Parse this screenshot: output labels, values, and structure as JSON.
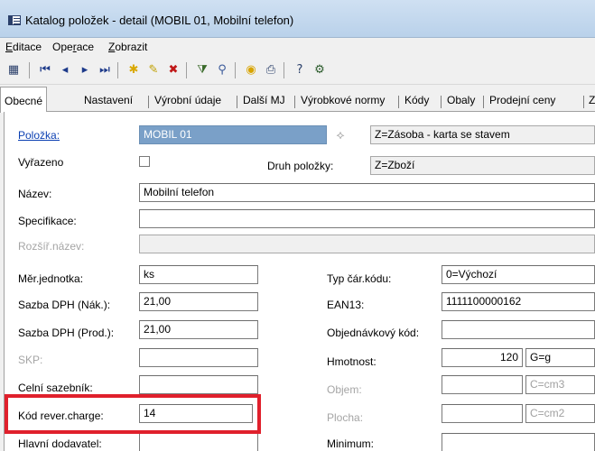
{
  "window": {
    "title": "Katalog položek - detail (MOBIL 01, Mobilní telefon)"
  },
  "menu": {
    "items": [
      {
        "u": "E",
        "rest": "ditace"
      },
      {
        "pre": "Ope",
        "u": "r",
        "rest": "ace"
      },
      {
        "u": "Z",
        "rest": "obrazit"
      }
    ]
  },
  "toolbar": {
    "icons": [
      "table-icon",
      "first-record-icon",
      "previous-record-icon",
      "next-record-icon",
      "last-record-icon",
      "new-record-icon",
      "edit-record-icon",
      "delete-record-icon",
      "filter-icon",
      "find-icon",
      "coins-icon",
      "print-icon",
      "help-icon",
      "tools-icon"
    ]
  },
  "tabs": [
    "Obecné",
    "Nastavení",
    "Výrobní údaje",
    "Další MJ",
    "Výrobkové normy",
    "Kódy",
    "Obaly",
    "Prodejní ceny",
    "Z"
  ],
  "form": {
    "polozka": {
      "label": "Položka:",
      "value": "MOBIL 01",
      "type_value": "Z=Zásoba - karta se stavem"
    },
    "vyrazeno": {
      "label": "Vyřazeno",
      "checked": false
    },
    "druh": {
      "label": "Druh položky:",
      "value": "Z=Zboží"
    },
    "nazev": {
      "label": "Název:",
      "value": "Mobilní telefon"
    },
    "specifikace": {
      "label": "Specifikace:",
      "value": ""
    },
    "rozsir_nazev": {
      "label": "Rozšíř.název:",
      "value": ""
    },
    "mer_jednotka": {
      "label": "Měr.jednotka:",
      "value": "ks"
    },
    "sazba_nak": {
      "label": "Sazba DPH (Nák.):",
      "value": "21,00"
    },
    "sazba_prod": {
      "label": "Sazba DPH (Prod.):",
      "value": "21,00"
    },
    "skp": {
      "label": "SKP:",
      "value": ""
    },
    "celni": {
      "label": "Celní sazebník:",
      "value": ""
    },
    "kod_rever": {
      "label": "Kód rever.charge:",
      "value": "14"
    },
    "hlavni_dodavatel": {
      "label": "Hlavní dodavatel:",
      "value": ""
    },
    "typ_car_kodu": {
      "label": "Typ čár.kódu:",
      "value": "0=Výchozí"
    },
    "ean13": {
      "label": "EAN13:",
      "value": "1111100000162"
    },
    "objednavkovy": {
      "label": "Objednávkový kód:",
      "value": ""
    },
    "hmotnost": {
      "label": "Hmotnost:",
      "value": "120",
      "unit": "G=g"
    },
    "objem": {
      "label": "Objem:",
      "value": "",
      "unit": "C=cm3"
    },
    "plocha": {
      "label": "Plocha:",
      "value": "",
      "unit": "C=cm2"
    },
    "minimum": {
      "label": "Minimum:",
      "value": ""
    }
  },
  "colors": {
    "highlight": "#e0202c",
    "link": "#0b3fb2",
    "selected_field": "#7aa0c8"
  }
}
